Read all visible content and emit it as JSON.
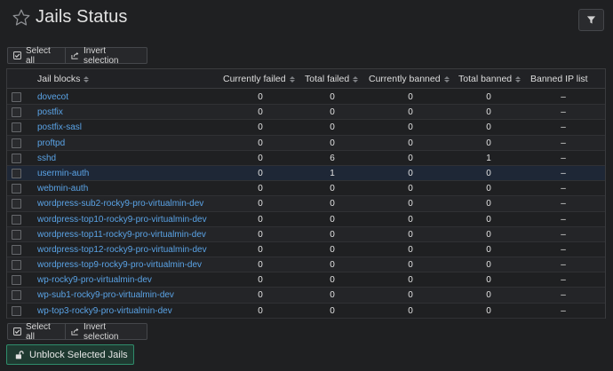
{
  "header": {
    "title": "Jails Status",
    "star_icon": "star-outline-icon",
    "filter_icon": "filter-icon"
  },
  "toolbar": {
    "select_all": "Select all",
    "invert_selection": "Invert selection"
  },
  "table": {
    "columns": [
      "Jail blocks",
      "Currently failed",
      "Total failed",
      "Currently banned",
      "Total banned",
      "Banned IP list"
    ],
    "rows": [
      {
        "name": "dovecot",
        "currently_failed": "0",
        "total_failed": "0",
        "currently_banned": "0",
        "total_banned": "0",
        "banned_ip_list": "–"
      },
      {
        "name": "postfix",
        "currently_failed": "0",
        "total_failed": "0",
        "currently_banned": "0",
        "total_banned": "0",
        "banned_ip_list": "–"
      },
      {
        "name": "postfix-sasl",
        "currently_failed": "0",
        "total_failed": "0",
        "currently_banned": "0",
        "total_banned": "0",
        "banned_ip_list": "–"
      },
      {
        "name": "proftpd",
        "currently_failed": "0",
        "total_failed": "0",
        "currently_banned": "0",
        "total_banned": "0",
        "banned_ip_list": "–"
      },
      {
        "name": "sshd",
        "currently_failed": "0",
        "total_failed": "6",
        "currently_banned": "0",
        "total_banned": "1",
        "banned_ip_list": "–"
      },
      {
        "name": "usermin-auth",
        "currently_failed": "0",
        "total_failed": "1",
        "currently_banned": "0",
        "total_banned": "0",
        "banned_ip_list": "–"
      },
      {
        "name": "webmin-auth",
        "currently_failed": "0",
        "total_failed": "0",
        "currently_banned": "0",
        "total_banned": "0",
        "banned_ip_list": "–"
      },
      {
        "name": "wordpress-sub2-rocky9-pro-virtualmin-dev",
        "currently_failed": "0",
        "total_failed": "0",
        "currently_banned": "0",
        "total_banned": "0",
        "banned_ip_list": "–"
      },
      {
        "name": "wordpress-top10-rocky9-pro-virtualmin-dev",
        "currently_failed": "0",
        "total_failed": "0",
        "currently_banned": "0",
        "total_banned": "0",
        "banned_ip_list": "–"
      },
      {
        "name": "wordpress-top11-rocky9-pro-virtualmin-dev",
        "currently_failed": "0",
        "total_failed": "0",
        "currently_banned": "0",
        "total_banned": "0",
        "banned_ip_list": "–"
      },
      {
        "name": "wordpress-top12-rocky9-pro-virtualmin-dev",
        "currently_failed": "0",
        "total_failed": "0",
        "currently_banned": "0",
        "total_banned": "0",
        "banned_ip_list": "–"
      },
      {
        "name": "wordpress-top9-rocky9-pro-virtualmin-dev",
        "currently_failed": "0",
        "total_failed": "0",
        "currently_banned": "0",
        "total_banned": "0",
        "banned_ip_list": "–"
      },
      {
        "name": "wp-rocky9-pro-virtualmin-dev",
        "currently_failed": "0",
        "total_failed": "0",
        "currently_banned": "0",
        "total_banned": "0",
        "banned_ip_list": "–"
      },
      {
        "name": "wp-sub1-rocky9-pro-virtualmin-dev",
        "currently_failed": "0",
        "total_failed": "0",
        "currently_banned": "0",
        "total_banned": "0",
        "banned_ip_list": "–"
      },
      {
        "name": "wp-top3-rocky9-pro-virtualmin-dev",
        "currently_failed": "0",
        "total_failed": "0",
        "currently_banned": "0",
        "total_banned": "0",
        "banned_ip_list": "–"
      }
    ],
    "highlighted_row": 5
  },
  "actions": {
    "unblock": "Unblock Selected Jails",
    "unblock_icon": "unlock-icon"
  },
  "colors": {
    "link": "#5aa3e6",
    "success_border": "#2f8c6b",
    "row_highlight": "#1e2736"
  }
}
